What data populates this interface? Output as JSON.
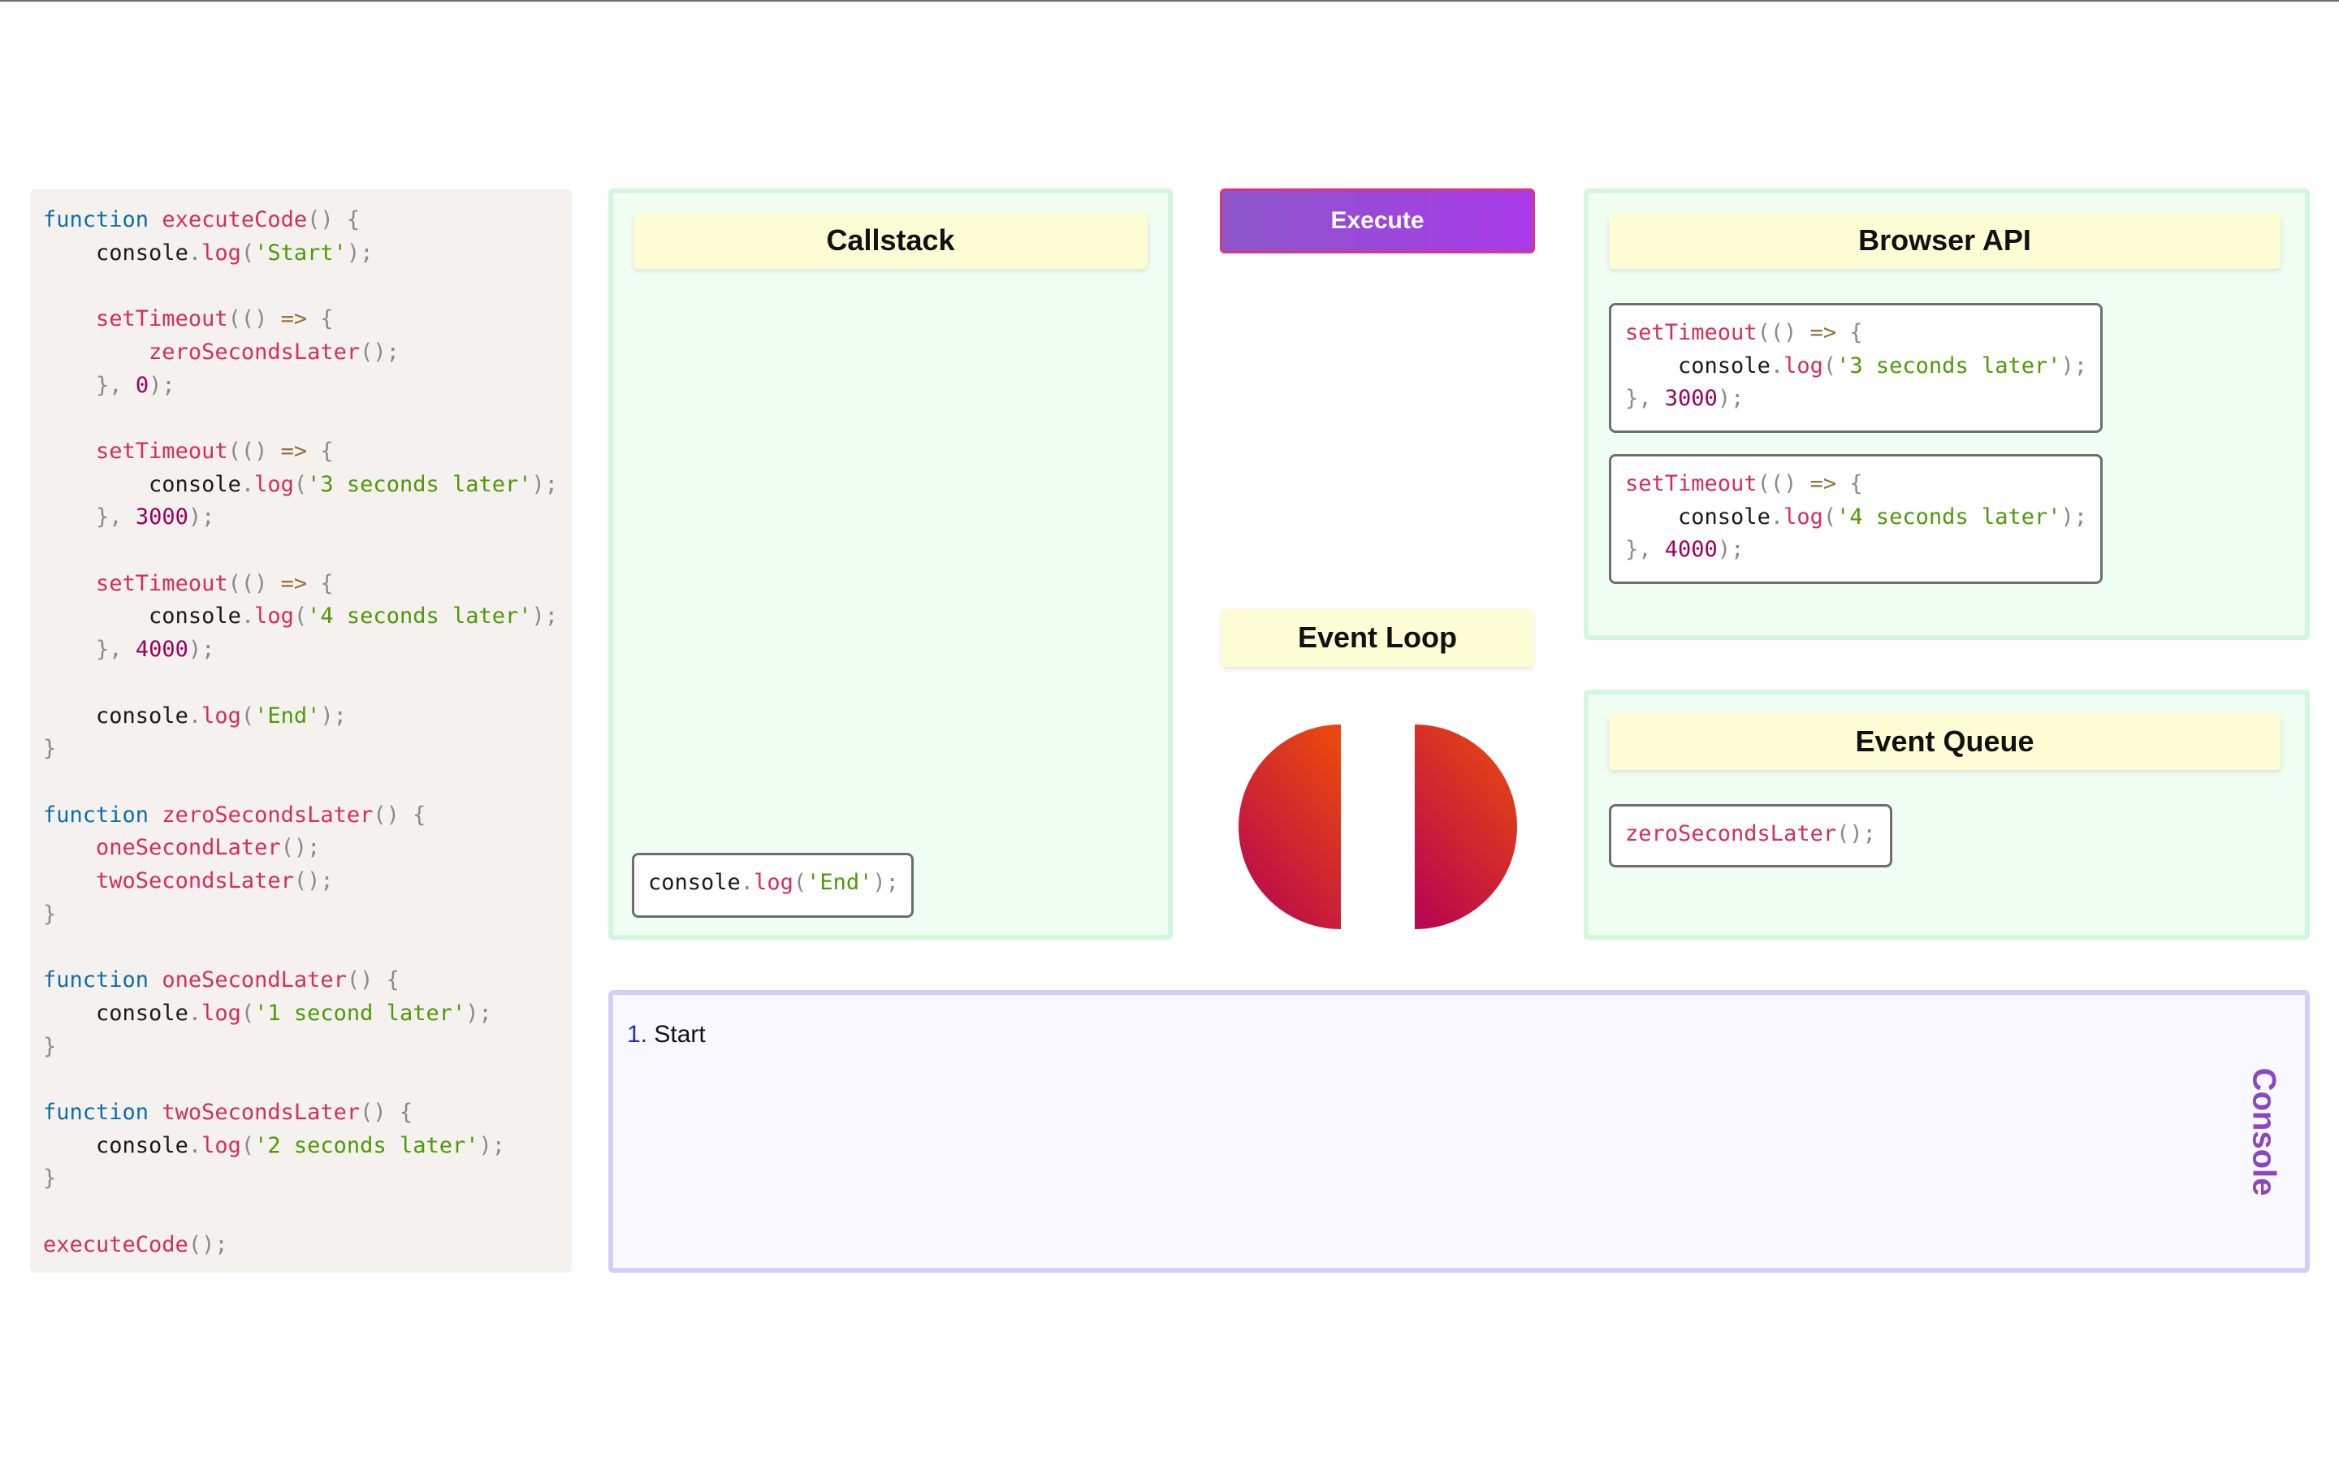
{
  "code": {
    "lines": [
      [
        [
          "kw",
          "function"
        ],
        [
          "plain",
          " "
        ],
        [
          "fn",
          "executeCode"
        ],
        [
          "punc",
          "() {"
        ]
      ],
      [
        [
          "plain",
          "    "
        ],
        [
          "id",
          "console"
        ],
        [
          "punc",
          "."
        ],
        [
          "fn",
          "log"
        ],
        [
          "punc",
          "("
        ],
        [
          "str",
          "'Start'"
        ],
        [
          "punc",
          ");"
        ]
      ],
      [],
      [
        [
          "plain",
          "    "
        ],
        [
          "fn",
          "setTimeout"
        ],
        [
          "punc",
          "(() "
        ],
        [
          "op",
          "=>"
        ],
        [
          "punc",
          " {"
        ]
      ],
      [
        [
          "plain",
          "        "
        ],
        [
          "fn",
          "zeroSecondsLater"
        ],
        [
          "punc",
          "();"
        ]
      ],
      [
        [
          "plain",
          "    "
        ],
        [
          "punc",
          "}, "
        ],
        [
          "num",
          "0"
        ],
        [
          "punc",
          ");"
        ]
      ],
      [],
      [
        [
          "plain",
          "    "
        ],
        [
          "fn",
          "setTimeout"
        ],
        [
          "punc",
          "(() "
        ],
        [
          "op",
          "=>"
        ],
        [
          "punc",
          " {"
        ]
      ],
      [
        [
          "plain",
          "        "
        ],
        [
          "id",
          "console"
        ],
        [
          "punc",
          "."
        ],
        [
          "fn",
          "log"
        ],
        [
          "punc",
          "("
        ],
        [
          "str",
          "'3 seconds later'"
        ],
        [
          "punc",
          ");"
        ]
      ],
      [
        [
          "plain",
          "    "
        ],
        [
          "punc",
          "}, "
        ],
        [
          "num",
          "3000"
        ],
        [
          "punc",
          ");"
        ]
      ],
      [],
      [
        [
          "plain",
          "    "
        ],
        [
          "fn",
          "setTimeout"
        ],
        [
          "punc",
          "(() "
        ],
        [
          "op",
          "=>"
        ],
        [
          "punc",
          " {"
        ]
      ],
      [
        [
          "plain",
          "        "
        ],
        [
          "id",
          "console"
        ],
        [
          "punc",
          "."
        ],
        [
          "fn",
          "log"
        ],
        [
          "punc",
          "("
        ],
        [
          "str",
          "'4 seconds later'"
        ],
        [
          "punc",
          ");"
        ]
      ],
      [
        [
          "plain",
          "    "
        ],
        [
          "punc",
          "}, "
        ],
        [
          "num",
          "4000"
        ],
        [
          "punc",
          ");"
        ]
      ],
      [],
      [
        [
          "plain",
          "    "
        ],
        [
          "id",
          "console"
        ],
        [
          "punc",
          "."
        ],
        [
          "fn",
          "log"
        ],
        [
          "punc",
          "("
        ],
        [
          "str",
          "'End'"
        ],
        [
          "punc",
          ");"
        ]
      ],
      [
        [
          "punc",
          "}"
        ]
      ],
      [],
      [
        [
          "kw",
          "function"
        ],
        [
          "plain",
          " "
        ],
        [
          "fn",
          "zeroSecondsLater"
        ],
        [
          "punc",
          "() {"
        ]
      ],
      [
        [
          "plain",
          "    "
        ],
        [
          "fn",
          "oneSecondLater"
        ],
        [
          "punc",
          "();"
        ]
      ],
      [
        [
          "plain",
          "    "
        ],
        [
          "fn",
          "twoSecondsLater"
        ],
        [
          "punc",
          "();"
        ]
      ],
      [
        [
          "punc",
          "}"
        ]
      ],
      [],
      [
        [
          "kw",
          "function"
        ],
        [
          "plain",
          " "
        ],
        [
          "fn",
          "oneSecondLater"
        ],
        [
          "punc",
          "() {"
        ]
      ],
      [
        [
          "plain",
          "    "
        ],
        [
          "id",
          "console"
        ],
        [
          "punc",
          "."
        ],
        [
          "fn",
          "log"
        ],
        [
          "punc",
          "("
        ],
        [
          "str",
          "'1 second later'"
        ],
        [
          "punc",
          ");"
        ]
      ],
      [
        [
          "punc",
          "}"
        ]
      ],
      [],
      [
        [
          "kw",
          "function"
        ],
        [
          "plain",
          " "
        ],
        [
          "fn",
          "twoSecondsLater"
        ],
        [
          "punc",
          "() {"
        ]
      ],
      [
        [
          "plain",
          "    "
        ],
        [
          "id",
          "console"
        ],
        [
          "punc",
          "."
        ],
        [
          "fn",
          "log"
        ],
        [
          "punc",
          "("
        ],
        [
          "str",
          "'2 seconds later'"
        ],
        [
          "punc",
          ");"
        ]
      ],
      [
        [
          "punc",
          "}"
        ]
      ],
      [],
      [
        [
          "fn",
          "executeCode"
        ],
        [
          "punc",
          "();"
        ]
      ]
    ]
  },
  "callstack": {
    "title": "Callstack",
    "frames": [
      [
        [
          [
            "id",
            "console"
          ],
          [
            "punc",
            "."
          ],
          [
            "fn",
            "log"
          ],
          [
            "punc",
            "("
          ],
          [
            "str",
            "'End'"
          ],
          [
            "punc",
            ");"
          ]
        ]
      ]
    ]
  },
  "execute_button": {
    "label": "Execute"
  },
  "event_loop": {
    "title": "Event Loop"
  },
  "browser_api": {
    "title": "Browser API",
    "tasks": [
      [
        [
          [
            "fn",
            "setTimeout"
          ],
          [
            "punc",
            "(() "
          ],
          [
            "op",
            "=>"
          ],
          [
            "punc",
            " {"
          ]
        ],
        [
          [
            "plain",
            "    "
          ],
          [
            "id",
            "console"
          ],
          [
            "punc",
            "."
          ],
          [
            "fn",
            "log"
          ],
          [
            "punc",
            "("
          ],
          [
            "str",
            "'3 seconds later'"
          ],
          [
            "punc",
            ");"
          ]
        ],
        [
          [
            "punc",
            "}, "
          ],
          [
            "num",
            "3000"
          ],
          [
            "punc",
            ");"
          ]
        ]
      ],
      [
        [
          [
            "fn",
            "setTimeout"
          ],
          [
            "punc",
            "(() "
          ],
          [
            "op",
            "=>"
          ],
          [
            "punc",
            " {"
          ]
        ],
        [
          [
            "plain",
            "    "
          ],
          [
            "id",
            "console"
          ],
          [
            "punc",
            "."
          ],
          [
            "fn",
            "log"
          ],
          [
            "punc",
            "("
          ],
          [
            "str",
            "'4 seconds later'"
          ],
          [
            "punc",
            ");"
          ]
        ],
        [
          [
            "punc",
            "}, "
          ],
          [
            "num",
            "4000"
          ],
          [
            "punc",
            ");"
          ]
        ]
      ]
    ]
  },
  "event_queue": {
    "title": "Event Queue",
    "items": [
      [
        [
          [
            "fn",
            "zeroSecondsLater"
          ],
          [
            "punc",
            "();"
          ]
        ]
      ]
    ]
  },
  "console": {
    "label": "Console",
    "lines": [
      {
        "num": "1.",
        "text": "Start"
      }
    ]
  },
  "colors": {
    "keyword": "#0f6fa8",
    "function": "#d62e5a",
    "string": "#4e9a06",
    "number": "#9c005d",
    "loop_gradient_start": "#e8470f",
    "loop_gradient_end": "#b8084f"
  },
  "icons": {
    "event_loop": "split-circle-icon"
  }
}
